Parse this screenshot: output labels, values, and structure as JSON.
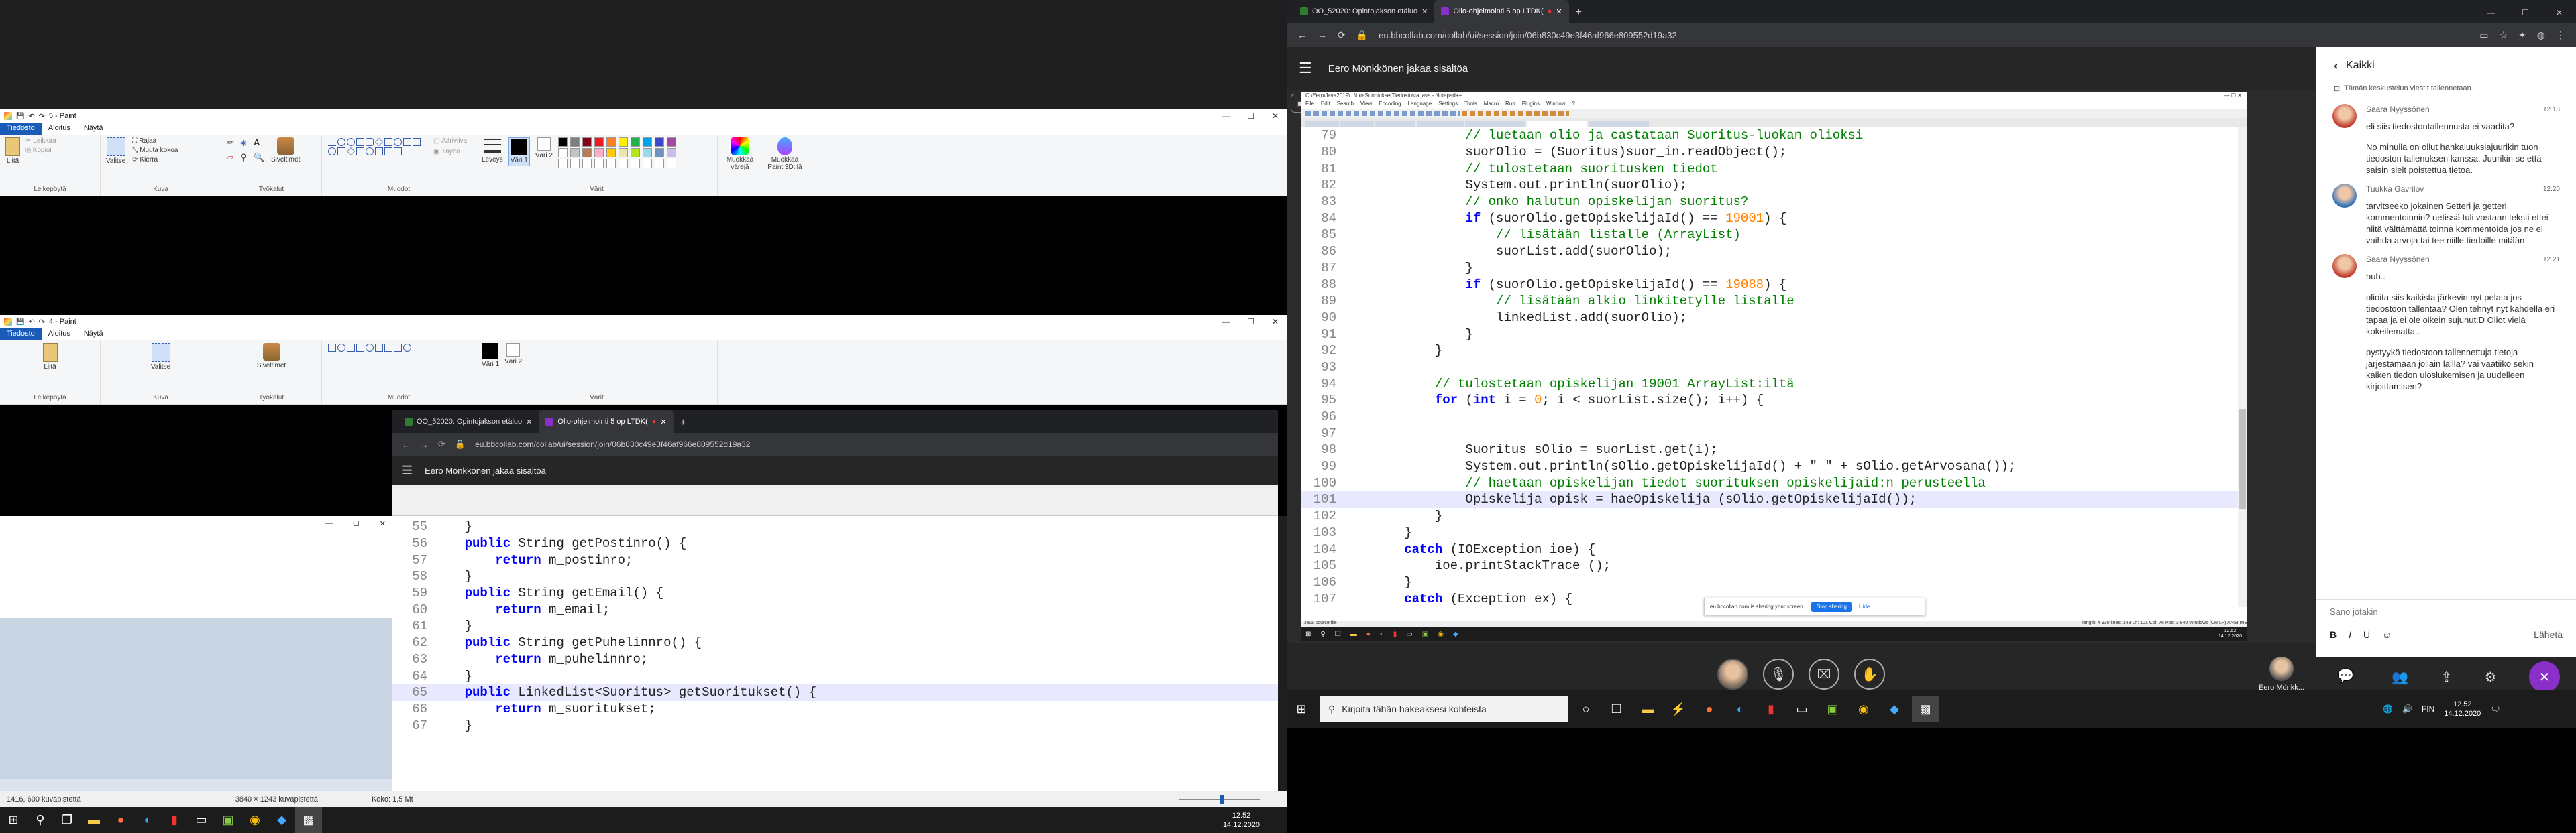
{
  "paint_top": {
    "title": "5 - Paint",
    "menu": [
      "Tiedosto",
      "Aloitus",
      "Näytä"
    ],
    "groups": {
      "clipboard": "Leikepöytä",
      "image": "Kuva",
      "tools": "Työkalut",
      "shapes": "Muodot",
      "colors": "Värit"
    },
    "buttons": {
      "paste": "Liitä",
      "cut": "Leikkaa",
      "copy": "Kopioi",
      "select": "Valitse",
      "crop": "Rajaa",
      "resize": "Muuta kokoa",
      "rotate": "Kierrä",
      "brushes": "Siveltimet",
      "outline": "Ääriviiva",
      "fill": "Täyttö",
      "size": "Leveys",
      "color1": "Väri 1",
      "color2": "Väri 2",
      "edit_colors": "Muokkaa värejä",
      "paint3d": "Muokkaa Paint 3D:llä"
    }
  },
  "paint_mid": {
    "title": "4 - Paint"
  },
  "paint_status": {
    "coords": "1416, 600 kuvapistettä",
    "dims": "3840 × 1243 kuvapistettä",
    "size": "Koko: 1,5 Mt"
  },
  "browser_small": {
    "tabs": [
      "OO_52020: Opintojakson etäluo",
      "Olio-ohjelmointi 5 op LTDK("
    ],
    "url": "eu.bbcollab.com/collab/ui/session/join/06b830c49e3f46af966e809552d19a32",
    "presenter": "Eero Mönkkönen jakaa sisältöä"
  },
  "code_small": [
    {
      "n": "55",
      "t": "    }"
    },
    {
      "n": "56",
      "t": "    public String getPostinro() {"
    },
    {
      "n": "57",
      "t": "        return m_postinro;"
    },
    {
      "n": "58",
      "t": "    }"
    },
    {
      "n": "59",
      "t": "    public String getEmail() {"
    },
    {
      "n": "60",
      "t": "        return m_email;"
    },
    {
      "n": "61",
      "t": "    }"
    },
    {
      "n": "62",
      "t": "    public String getPuhelinnro() {"
    },
    {
      "n": "63",
      "t": "        return m_puhelinnro;"
    },
    {
      "n": "64",
      "t": "    }"
    },
    {
      "n": "65",
      "t": "    public LinkedList<Suoritus> getSuoritukset() {"
    },
    {
      "n": "66",
      "t": "        return m_suoritukset;"
    },
    {
      "n": "67",
      "t": "    }"
    }
  ],
  "browser_big": {
    "tabs": [
      "OO_52020: Opintojakson etäluo",
      "Olio-ohjelmointi 5 op LTDK("
    ],
    "url": "eu.bbcollab.com/collab/ui/session/join/06b830c49e3f46af966e809552d19a32",
    "presenter": "Eero Mönkkönen jakaa sisältöä"
  },
  "code_big": [
    {
      "n": "79",
      "t": "                // luetaan olio ja castataan Suoritus-luokan olioksi",
      "k": "cm"
    },
    {
      "n": "80",
      "t": "                suorOlio = (Suoritus)suor_in.readObject();"
    },
    {
      "n": "81",
      "t": "                // tulostetaan suoritusken tiedot",
      "k": "cm"
    },
    {
      "n": "82",
      "t": "                System.out.println(suorOlio);"
    },
    {
      "n": "83",
      "t": "                // onko halutun opiskelijan suoritus?",
      "k": "cm"
    },
    {
      "n": "84",
      "t": "                if (suorOlio.getOpiskelijaId() == 19001) {"
    },
    {
      "n": "85",
      "t": "                    // lisätään listalle (ArrayList)",
      "k": "cm"
    },
    {
      "n": "86",
      "t": "                    suorList.add(suorOlio);"
    },
    {
      "n": "87",
      "t": "                }"
    },
    {
      "n": "88",
      "t": "                if (suorOlio.getOpiskelijaId() == 19088) {"
    },
    {
      "n": "89",
      "t": "                    // lisätään alkio linkitetylle listalle",
      "k": "cm"
    },
    {
      "n": "90",
      "t": "                    linkedList.add(suorOlio);"
    },
    {
      "n": "91",
      "t": "                }"
    },
    {
      "n": "92",
      "t": "            }"
    },
    {
      "n": "93",
      "t": ""
    },
    {
      "n": "94",
      "t": "            // tulostetaan opiskelijan 19001 ArrayList:iltä",
      "k": "cm"
    },
    {
      "n": "95",
      "t": "            for (int i = 0; i < suorList.size(); i++) {"
    },
    {
      "n": "96",
      "t": ""
    },
    {
      "n": "97",
      "t": ""
    },
    {
      "n": "98",
      "t": "                Suoritus sOlio = suorList.get(i);"
    },
    {
      "n": "99",
      "t": "                System.out.println(sOlio.getOpiskelijaId() + \" \" + sOlio.getArvosana());"
    },
    {
      "n": "100",
      "t": "                // haetaan opiskelijan tiedot suorituksen opiskelijaid:n perusteella",
      "k": "cm"
    },
    {
      "n": "101",
      "t": "                Opiskelija opisk = haeOpiskelija (sOlio.getOpiskelijaId());"
    },
    {
      "n": "102",
      "t": "            }"
    },
    {
      "n": "103",
      "t": "        }"
    },
    {
      "n": "104",
      "t": "        catch (IOException ioe) {"
    },
    {
      "n": "105",
      "t": "            ioe.printStackTrace ();"
    },
    {
      "n": "106",
      "t": "        }"
    },
    {
      "n": "107",
      "t": "        catch (Exception ex) {"
    }
  ],
  "sharing_notice": {
    "text": "eu.bbcollab.com is sharing your screen.",
    "stop": "Stop sharing",
    "hide": "Hide"
  },
  "chat": {
    "back_label": "Kaikki",
    "notice": "Tämän keskustelun viestit tallennetaan.",
    "messages": [
      {
        "author": "Saara Nyyssönen",
        "time": "12.18",
        "lines": [
          "eli siis tiedostontallennusta ei vaadita?",
          "",
          "No minulla on ollut hankaluuksiajuurikin tuon tiedoston tallenuksen kanssa. Juurikin se että saisin sielt poistettua tietoa."
        ]
      },
      {
        "author": "Tuukka Gavrilov",
        "time": "12.20",
        "lines": [
          "tarvitseeko jokainen Setteri ja getteri kommentoinnin? netissä tuli vastaan teksti ettei niitä välttämättä toinna kommentoida jos ne ei vaihda arvoja tai tee niille tiedoille mitään"
        ]
      },
      {
        "author": "Saara Nyyssönen",
        "time": "12.21",
        "lines": [
          "huh..",
          "",
          "olioita siis kaikista järkevin nyt pelata jos tiedostoon tallentaa? Olen tehnyt nyt kahdella eri tapaa ja ei ole oikein sujunut:D Oliot vielä kokeilematta..",
          "",
          "pystyykö tiedostoon tallennettuja tietoja järjestämään jollain lailla? vai vaatiiko sekin kaiken tiedon uloslukemisen ja uudelleen kirjoittamisen?"
        ]
      }
    ],
    "input_placeholder": "Sano jotakin",
    "send_label": "Lähetä",
    "format_buttons": [
      "B",
      "I",
      "U"
    ]
  },
  "taskbar_left": {
    "time": "12.52",
    "date": "14.12.2020"
  },
  "taskbar_right": {
    "search_placeholder": "Kirjoita tähän hakeaksesi kohteista",
    "time": "12.52",
    "date": "14.12.2020",
    "lang": "FIN"
  },
  "inner_status": {
    "left": "Java source file",
    "time": "12.52",
    "date": "14.12.2020"
  },
  "participant": {
    "name": "Eero Mönkk..."
  },
  "colors": {
    "accent": "#1a5bb8",
    "bb_purple": "#8b2fc9",
    "bb_blue": "#2f6fd6"
  }
}
